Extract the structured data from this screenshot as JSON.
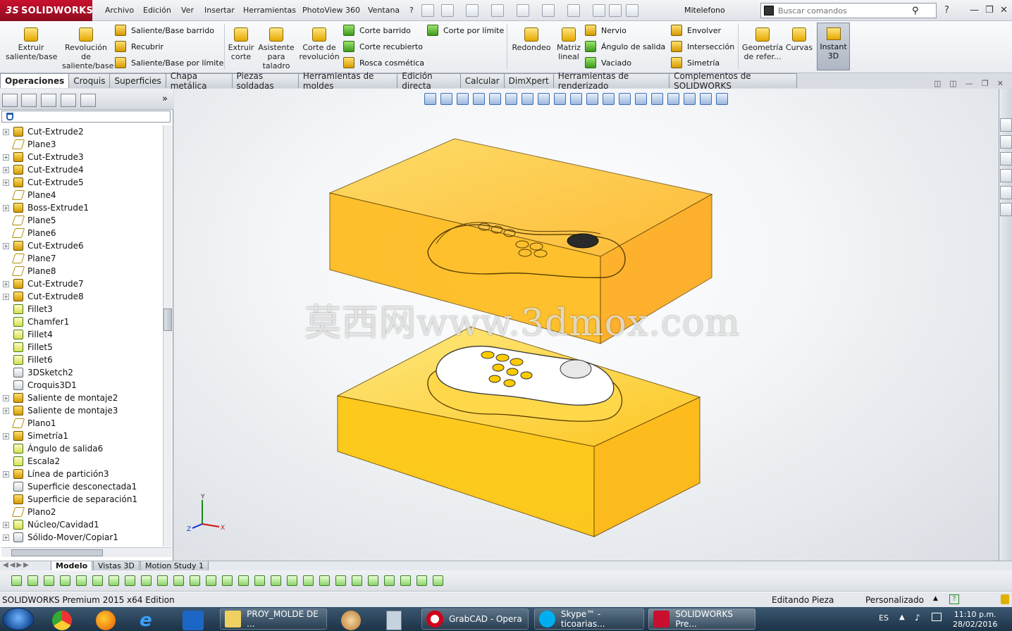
{
  "app": {
    "brand": "SOLIDWORKS",
    "brand_prefix": "3S",
    "document_title": "Mitelefono",
    "menu": [
      "Archivo",
      "Edición",
      "Ver",
      "Insertar",
      "Herramientas",
      "PhotoView 360",
      "Ventana",
      "?"
    ],
    "search_placeholder": "Buscar comandos"
  },
  "command_manager": {
    "extruir_saliente": "Extruir saliente/base",
    "revolucion_saliente": "Revolución de saliente/base",
    "saliente_barrido": "Saliente/Base barrido",
    "recubrir": "Recubrir",
    "saliente_limite": "Saliente/Base por límite",
    "extruir_corte": "Extruir corte",
    "asistente_taladro": "Asistente para taladro",
    "corte_revolucion": "Corte de revolución",
    "corte_barrido": "Corte barrido",
    "corte_recubierto": "Corte recubierto",
    "rosca_cosmetica": "Rosca cosmética",
    "corte_limite": "Corte por límite",
    "redondeo": "Redondeo",
    "matriz_lineal": "Matriz lineal",
    "nervio": "Nervio",
    "angulo_salida": "Ángulo de salida",
    "vaciado": "Vaciado",
    "envolver": "Envolver",
    "interseccion": "Intersección",
    "simetria": "Simetría",
    "geometria_ref": "Geometría de refer...",
    "curvas": "Curvas",
    "instant3d": "Instant 3D"
  },
  "tabs": [
    "Operaciones",
    "Croquis",
    "Superficies",
    "Chapa metálica",
    "Piezas soldadas",
    "Herramientas de moldes",
    "Edición directa",
    "Calcular",
    "DimXpert",
    "Herramientas de renderizado",
    "Complementos de SOLIDWORKS"
  ],
  "feature_tree": [
    {
      "label": "Cut-Extrude2",
      "icon": "cut-extrude-icon",
      "expandable": true
    },
    {
      "label": "Plane3",
      "icon": "plane-icon",
      "expandable": false
    },
    {
      "label": "Cut-Extrude3",
      "icon": "cut-extrude-icon",
      "expandable": true
    },
    {
      "label": "Cut-Extrude4",
      "icon": "cut-extrude-icon",
      "expandable": true
    },
    {
      "label": "Cut-Extrude5",
      "icon": "cut-extrude-icon",
      "expandable": true
    },
    {
      "label": "Plane4",
      "icon": "plane-icon",
      "expandable": false
    },
    {
      "label": "Boss-Extrude1",
      "icon": "boss-extrude-icon",
      "expandable": true
    },
    {
      "label": "Plane5",
      "icon": "plane-icon",
      "expandable": false
    },
    {
      "label": "Plane6",
      "icon": "plane-icon",
      "expandable": false
    },
    {
      "label": "Cut-Extrude6",
      "icon": "cut-extrude-icon",
      "expandable": true
    },
    {
      "label": "Plane7",
      "icon": "plane-icon",
      "expandable": false
    },
    {
      "label": "Plane8",
      "icon": "plane-icon",
      "expandable": false
    },
    {
      "label": "Cut-Extrude7",
      "icon": "cut-extrude-icon",
      "expandable": true
    },
    {
      "label": "Cut-Extrude8",
      "icon": "cut-extrude-icon",
      "expandable": true
    },
    {
      "label": "Fillet3",
      "icon": "fillet-icon",
      "expandable": false
    },
    {
      "label": "Chamfer1",
      "icon": "chamfer-icon",
      "expandable": false
    },
    {
      "label": "Fillet4",
      "icon": "fillet-icon",
      "expandable": false
    },
    {
      "label": "Fillet5",
      "icon": "fillet-icon",
      "expandable": false
    },
    {
      "label": "Fillet6",
      "icon": "fillet-icon",
      "expandable": false
    },
    {
      "label": "3DSketch2",
      "icon": "3d-sketch-icon",
      "expandable": false
    },
    {
      "label": "Croquis3D1",
      "icon": "3d-sketch-icon",
      "expandable": false
    },
    {
      "label": "Saliente de montaje2",
      "icon": "mounting-boss-icon",
      "expandable": true
    },
    {
      "label": "Saliente de montaje3",
      "icon": "mounting-boss-icon",
      "expandable": true
    },
    {
      "label": "Plano1",
      "icon": "plane-icon",
      "expandable": false
    },
    {
      "label": "Simetría1",
      "icon": "mirror-icon",
      "expandable": true
    },
    {
      "label": "Ángulo de salida6",
      "icon": "draft-icon",
      "expandable": false
    },
    {
      "label": "Escala2",
      "icon": "scale-icon",
      "expandable": false
    },
    {
      "label": "Línea de partición3",
      "icon": "split-line-icon",
      "expandable": true
    },
    {
      "label": "Superficie desconectada1",
      "icon": "knit-surface-icon",
      "expandable": false
    },
    {
      "label": "Superficie de separación1",
      "icon": "parting-surface-icon",
      "expandable": false
    },
    {
      "label": "Plano2",
      "icon": "plane-icon",
      "expandable": false
    },
    {
      "label": "Núcleo/Cavidad1",
      "icon": "core-cavity-icon",
      "expandable": true
    },
    {
      "label": "Sólido-Mover/Copiar1",
      "icon": "move-copy-icon",
      "expandable": true
    }
  ],
  "viewport": {
    "watermark": "莫西网www.3dmox.com",
    "triad": {
      "x": "X",
      "y": "Y",
      "z": "Z"
    }
  },
  "model_tabs": [
    "Modelo",
    "Vistas 3D",
    "Motion Study 1"
  ],
  "status": {
    "edition": "SOLIDWORKS Premium 2015 x64 Edition",
    "mode": "Editando Pieza",
    "units": "Personalizado",
    "help": "?"
  },
  "taskbar": {
    "items": [
      "PROY_MOLDE DE ...",
      "GrabCAD - Opera",
      "Skype™ - ticoarias...",
      "SOLIDWORKS Pre..."
    ],
    "lang": "ES",
    "time": "11:10 p.m.",
    "date": "28/02/2016"
  },
  "colors": {
    "mold_top": "#ffb300",
    "mold_bottom": "#ffc400",
    "accent": "#c8102e",
    "brand_red": "#c8102e"
  }
}
